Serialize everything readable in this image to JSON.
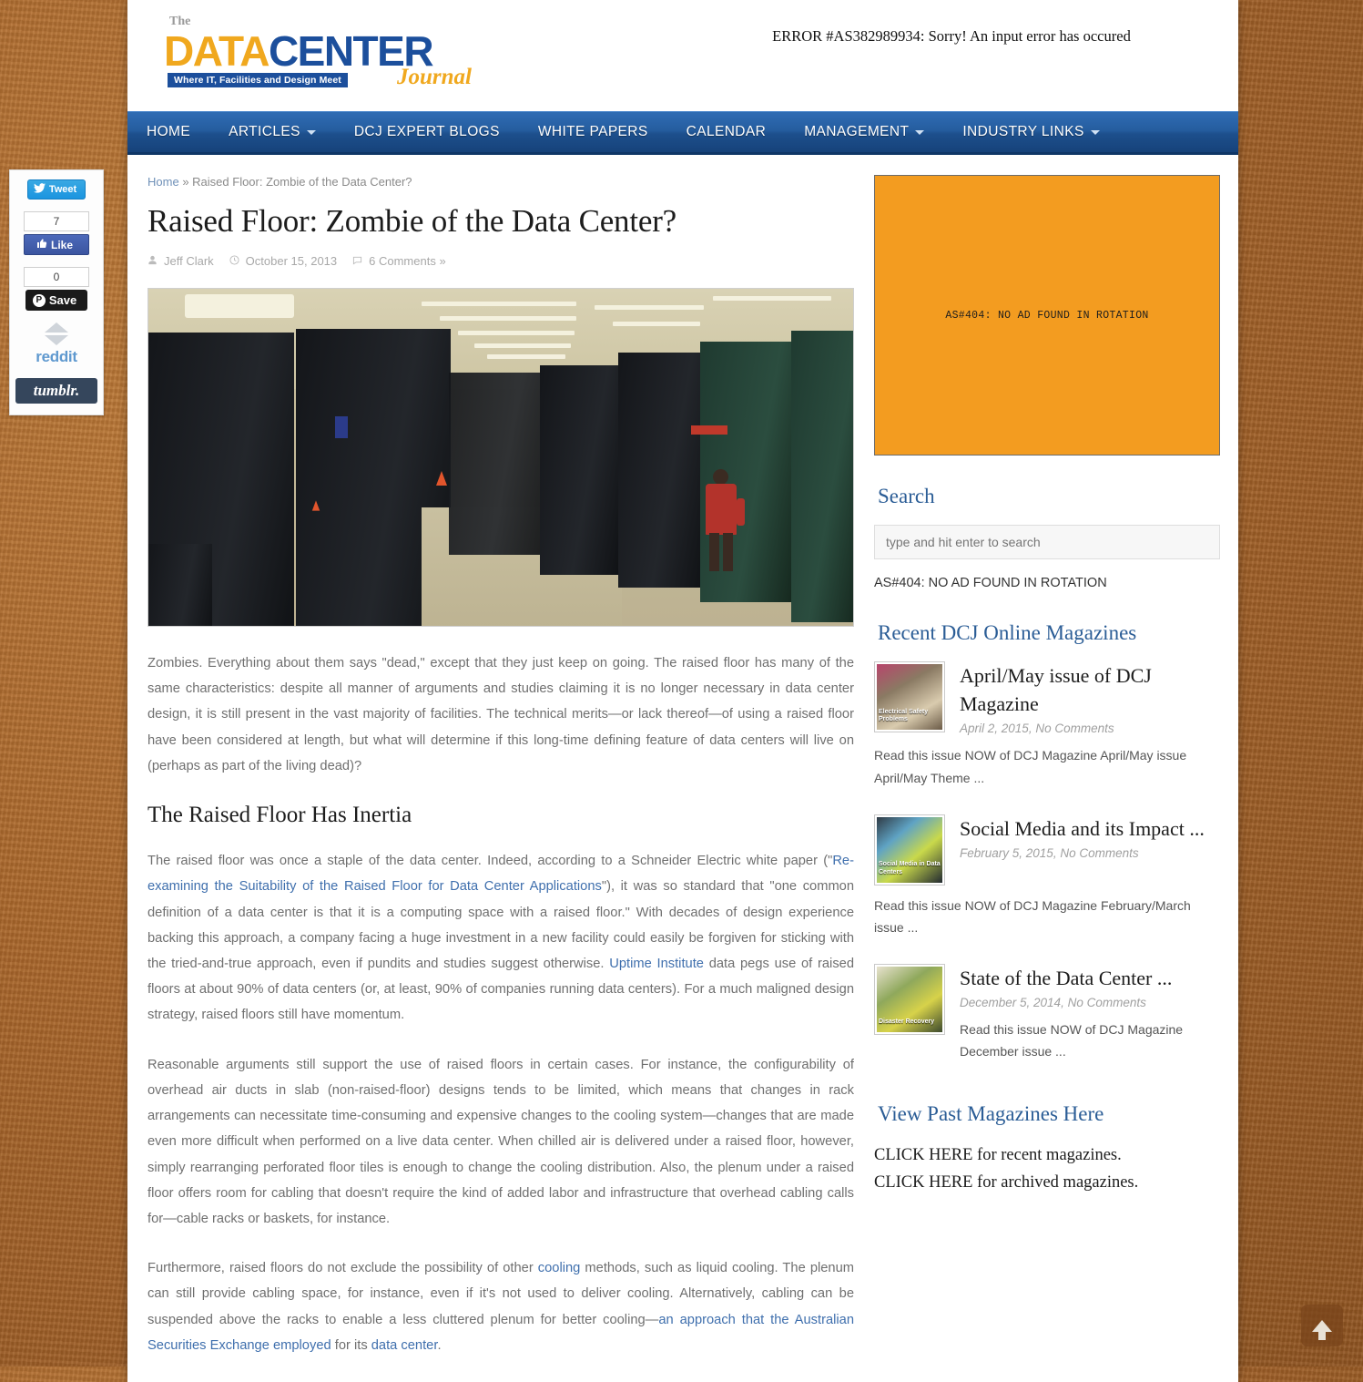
{
  "header": {
    "logo": {
      "the": "The",
      "data": "DATA",
      "center": "CENTER",
      "tagline": "Where IT, Facilities and Design Meet",
      "journal": "Journal"
    },
    "error_banner": "ERROR #AS382989934: Sorry! An input error has occured"
  },
  "nav": {
    "items": [
      {
        "label": "HOME",
        "has_dropdown": false
      },
      {
        "label": "ARTICLES",
        "has_dropdown": true
      },
      {
        "label": "DCJ EXPERT BLOGS",
        "has_dropdown": false
      },
      {
        "label": "WHITE PAPERS",
        "has_dropdown": false
      },
      {
        "label": "CALENDAR",
        "has_dropdown": false
      },
      {
        "label": "MANAGEMENT",
        "has_dropdown": true
      },
      {
        "label": "INDUSTRY LINKS",
        "has_dropdown": true
      }
    ]
  },
  "social": {
    "tweet_label": "Tweet",
    "facebook_count": "7",
    "like_label": "Like",
    "pinterest_count": "0",
    "pinterest_label": "Save",
    "pinterest_glyph": "P",
    "reddit_label": "reddit",
    "tumblr_label": "tumblr."
  },
  "breadcrumb": {
    "home": "Home",
    "separator": "»",
    "current": "Raised Floor: Zombie of the Data Center?"
  },
  "article": {
    "title": "Raised Floor: Zombie of the Data Center?",
    "author": "Jeff Clark",
    "date": "October 15, 2013",
    "comments": "6 Comments »",
    "section_heading": "The Raised Floor Has Inertia",
    "paragraph_1": "Zombies. Everything about them says \"dead,\" except that they just keep on going. The raised floor has many of the same characteristics: despite all manner of arguments and studies claiming it is no longer necessary in data center design, it is still present in the vast majority of facilities. The technical merits—or lack thereof—of using a raised floor have been considered at length, but what will determine if this long-time defining feature of data centers will live on (perhaps as part of the living dead)?",
    "p2_part1": "The raised floor was once a staple of the data center. Indeed, according to a Schneider Electric white paper (\"",
    "p2_link1": "Re-examining the Suitability of the Raised Floor for Data Center Applications",
    "p2_part2": "\"), it was so standard that \"one common definition of a data center is that it is a computing space with a raised floor.\" With decades of design experience backing this approach, a company facing a huge investment in a new facility could easily be forgiven for sticking with the tried-and-true approach, even if pundits and studies suggest otherwise. ",
    "p2_link2": "Uptime Institute",
    "p2_part3": " data pegs use of raised floors at about 90% of data centers (or, at least, 90% of companies running data centers). For a much maligned design strategy, raised floors still have momentum.",
    "paragraph_3": "Reasonable arguments still support the use of raised floors in certain cases. For instance, the configurability of overhead air ducts in slab (non-raised-floor) designs tends to be limited, which means that changes in rack arrangements can necessitate time-consuming and expensive changes to the cooling system—changes that are made even more difficult when performed on a live data center. When chilled air is delivered under a raised floor, however, simply rearranging perforated floor tiles is enough to change the cooling distribution. Also, the plenum under a raised floor offers room for cabling that doesn't require the kind of added labor and infrastructure that overhead cabling calls for—cable racks or baskets, for instance.",
    "p4_part1": "Furthermore, raised floors do not exclude the possibility of other ",
    "p4_link1": "cooling",
    "p4_part2": " methods, such as liquid cooling. The plenum can still provide cabling space, for instance, even if it's not used to deliver cooling. Alternatively, cabling can be suspended above the racks to enable a less cluttered plenum for better cooling—",
    "p4_link2": "an approach that the Australian Securities Exchange employed",
    "p4_part3": " for its ",
    "p4_link3": "data center",
    "p4_part4": "."
  },
  "sidebar": {
    "ad_placeholder": "AS#404: NO AD FOUND IN ROTATION",
    "search_heading": "Search",
    "search_placeholder": "type and hit enter to search",
    "search_value": "",
    "ad_error_text": "AS#404: NO AD FOUND IN ROTATION",
    "magazines_heading": "Recent DCJ Online Magazines",
    "magazines": [
      {
        "title": "April/May issue of DCJ Magazine",
        "date": "April 2, 2015",
        "comments": "No Comments",
        "excerpt": "Read this issue NOW of DCJ Magazine April/May issue April/May Theme ...",
        "thumb_label": "Electrical Safety Problems"
      },
      {
        "title": "Social Media and its Impact ...",
        "date": "February 5, 2015",
        "comments": "No Comments",
        "excerpt": "Read this issue NOW of DCJ Magazine February/March issue   ...",
        "thumb_label": "Social Media in Data Centers"
      },
      {
        "title": "State of the Data Center ...",
        "date": "December 5, 2014",
        "comments": "No Comments",
        "excerpt": "Read this issue NOW of DCJ Magazine December issue    ...",
        "thumb_label": "Disaster Recovery"
      }
    ],
    "past_heading": "View Past Magazines Here",
    "past_line_1": "CLICK HERE for recent magazines.",
    "past_line_2": "CLICK HERE for archived magazines."
  },
  "scroll_top": {
    "label": "Back to top"
  }
}
